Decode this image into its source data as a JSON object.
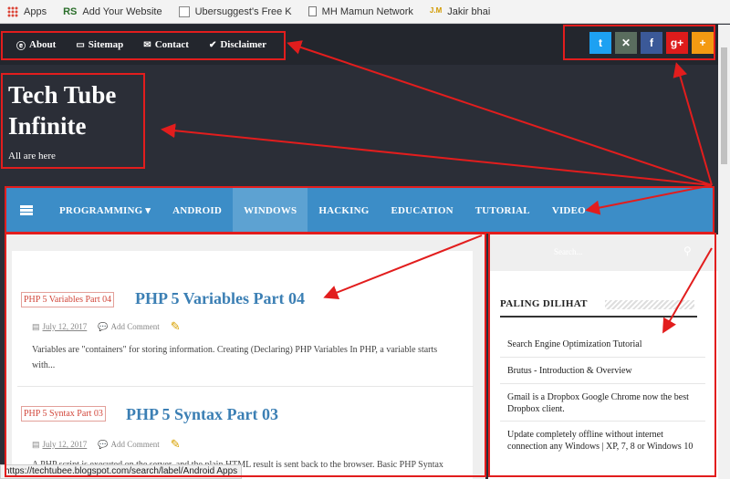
{
  "bookmarks": [
    {
      "label": "Apps",
      "icon": "apps-grid-icon"
    },
    {
      "label": "Add Your Website",
      "icon": "rs-logo-icon"
    },
    {
      "label": "Ubersuggest's Free K",
      "icon": "ubersuggest-icon"
    },
    {
      "label": "MH Mamun Network",
      "icon": "document-icon"
    },
    {
      "label": "Jakir bhai",
      "icon": "jm-logo-icon"
    }
  ],
  "topnav": {
    "items": [
      {
        "label": "About",
        "icon": "ie-icon"
      },
      {
        "label": "Sitemap",
        "icon": "folder-icon"
      },
      {
        "label": "Contact",
        "icon": "envelope-icon"
      },
      {
        "label": "Disclaimer",
        "icon": "check-circle-icon"
      }
    ]
  },
  "social": [
    {
      "name": "twitter",
      "glyph": "t",
      "color": "#1da1f2"
    },
    {
      "name": "delicious",
      "glyph": "✕",
      "color": "#5a6d5e"
    },
    {
      "name": "facebook",
      "glyph": "f",
      "color": "#3b5998"
    },
    {
      "name": "google-plus",
      "glyph": "g+",
      "color": "#dd1b1b"
    },
    {
      "name": "add",
      "glyph": "+",
      "color": "#f49a12"
    }
  ],
  "site": {
    "title": "Tech Tube Infinite",
    "tagline": "All are here"
  },
  "mainnav": {
    "items": [
      {
        "label": "PROGRAMMING ▾",
        "active": false
      },
      {
        "label": "ANDROID",
        "active": false
      },
      {
        "label": "WINDOWS",
        "active": true
      },
      {
        "label": "HACKING",
        "active": false
      },
      {
        "label": "EDUCATION",
        "active": false
      },
      {
        "label": "TUTORIAL",
        "active": false
      },
      {
        "label": "VIDEO",
        "active": false
      }
    ]
  },
  "posts": [
    {
      "thumb_label": "PHP 5 Variables Part 04",
      "title": "PHP 5 Variables Part 04",
      "date": "July 12, 2017",
      "comment": "Add Comment",
      "excerpt": "Variables are \"containers\" for storing information. Creating (Declaring) PHP Variables In PHP, a variable starts with..."
    },
    {
      "thumb_label": "PHP 5 Syntax Part 03",
      "title": "PHP 5 Syntax Part 03",
      "date": "July 12, 2017",
      "comment": "Add Comment",
      "excerpt": "A PHP script is executed on the server, and the plain HTML result is sent back to the browser. Basic PHP Syntax"
    }
  ],
  "sidebar": {
    "search_placeholder": "Search...",
    "widget_title": "PALING DILIHAT",
    "popular": [
      "Search Engine Optimization Tutorial",
      "Brutus - Introduction & Overview",
      "Gmail is a Dropbox Google Chrome now the best Dropbox client.",
      "Update completely offline without internet connection any Windows | XP, 7, 8 or Windows 10"
    ]
  },
  "status_url": "https://techtubee.blogspot.com/search/label/Android Apps"
}
